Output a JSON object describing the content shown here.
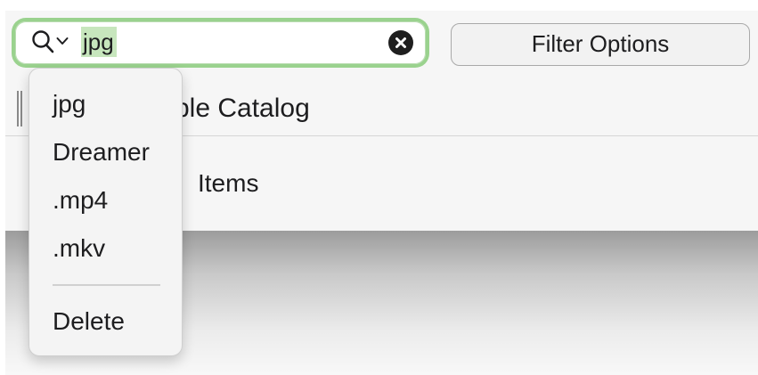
{
  "toolbar": {
    "search": {
      "value": "jpg",
      "icon": "magnifying-glass-icon",
      "menu_indicator_icon": "chevron-down-icon",
      "clear_icon": "xmark-circle-icon",
      "focus_ring_color": "#9ad28e",
      "selection_color": "#c7e6bd"
    },
    "filter_button_label": "Filter Options"
  },
  "title": {
    "text": "ple Catalog"
  },
  "content": {
    "items_label": "Items"
  },
  "search_menu": {
    "items": [
      {
        "label": "jpg"
      },
      {
        "label": "Dreamer"
      },
      {
        "label": ".mp4"
      },
      {
        "label": ".mkv"
      }
    ],
    "delete_label": "Delete"
  }
}
